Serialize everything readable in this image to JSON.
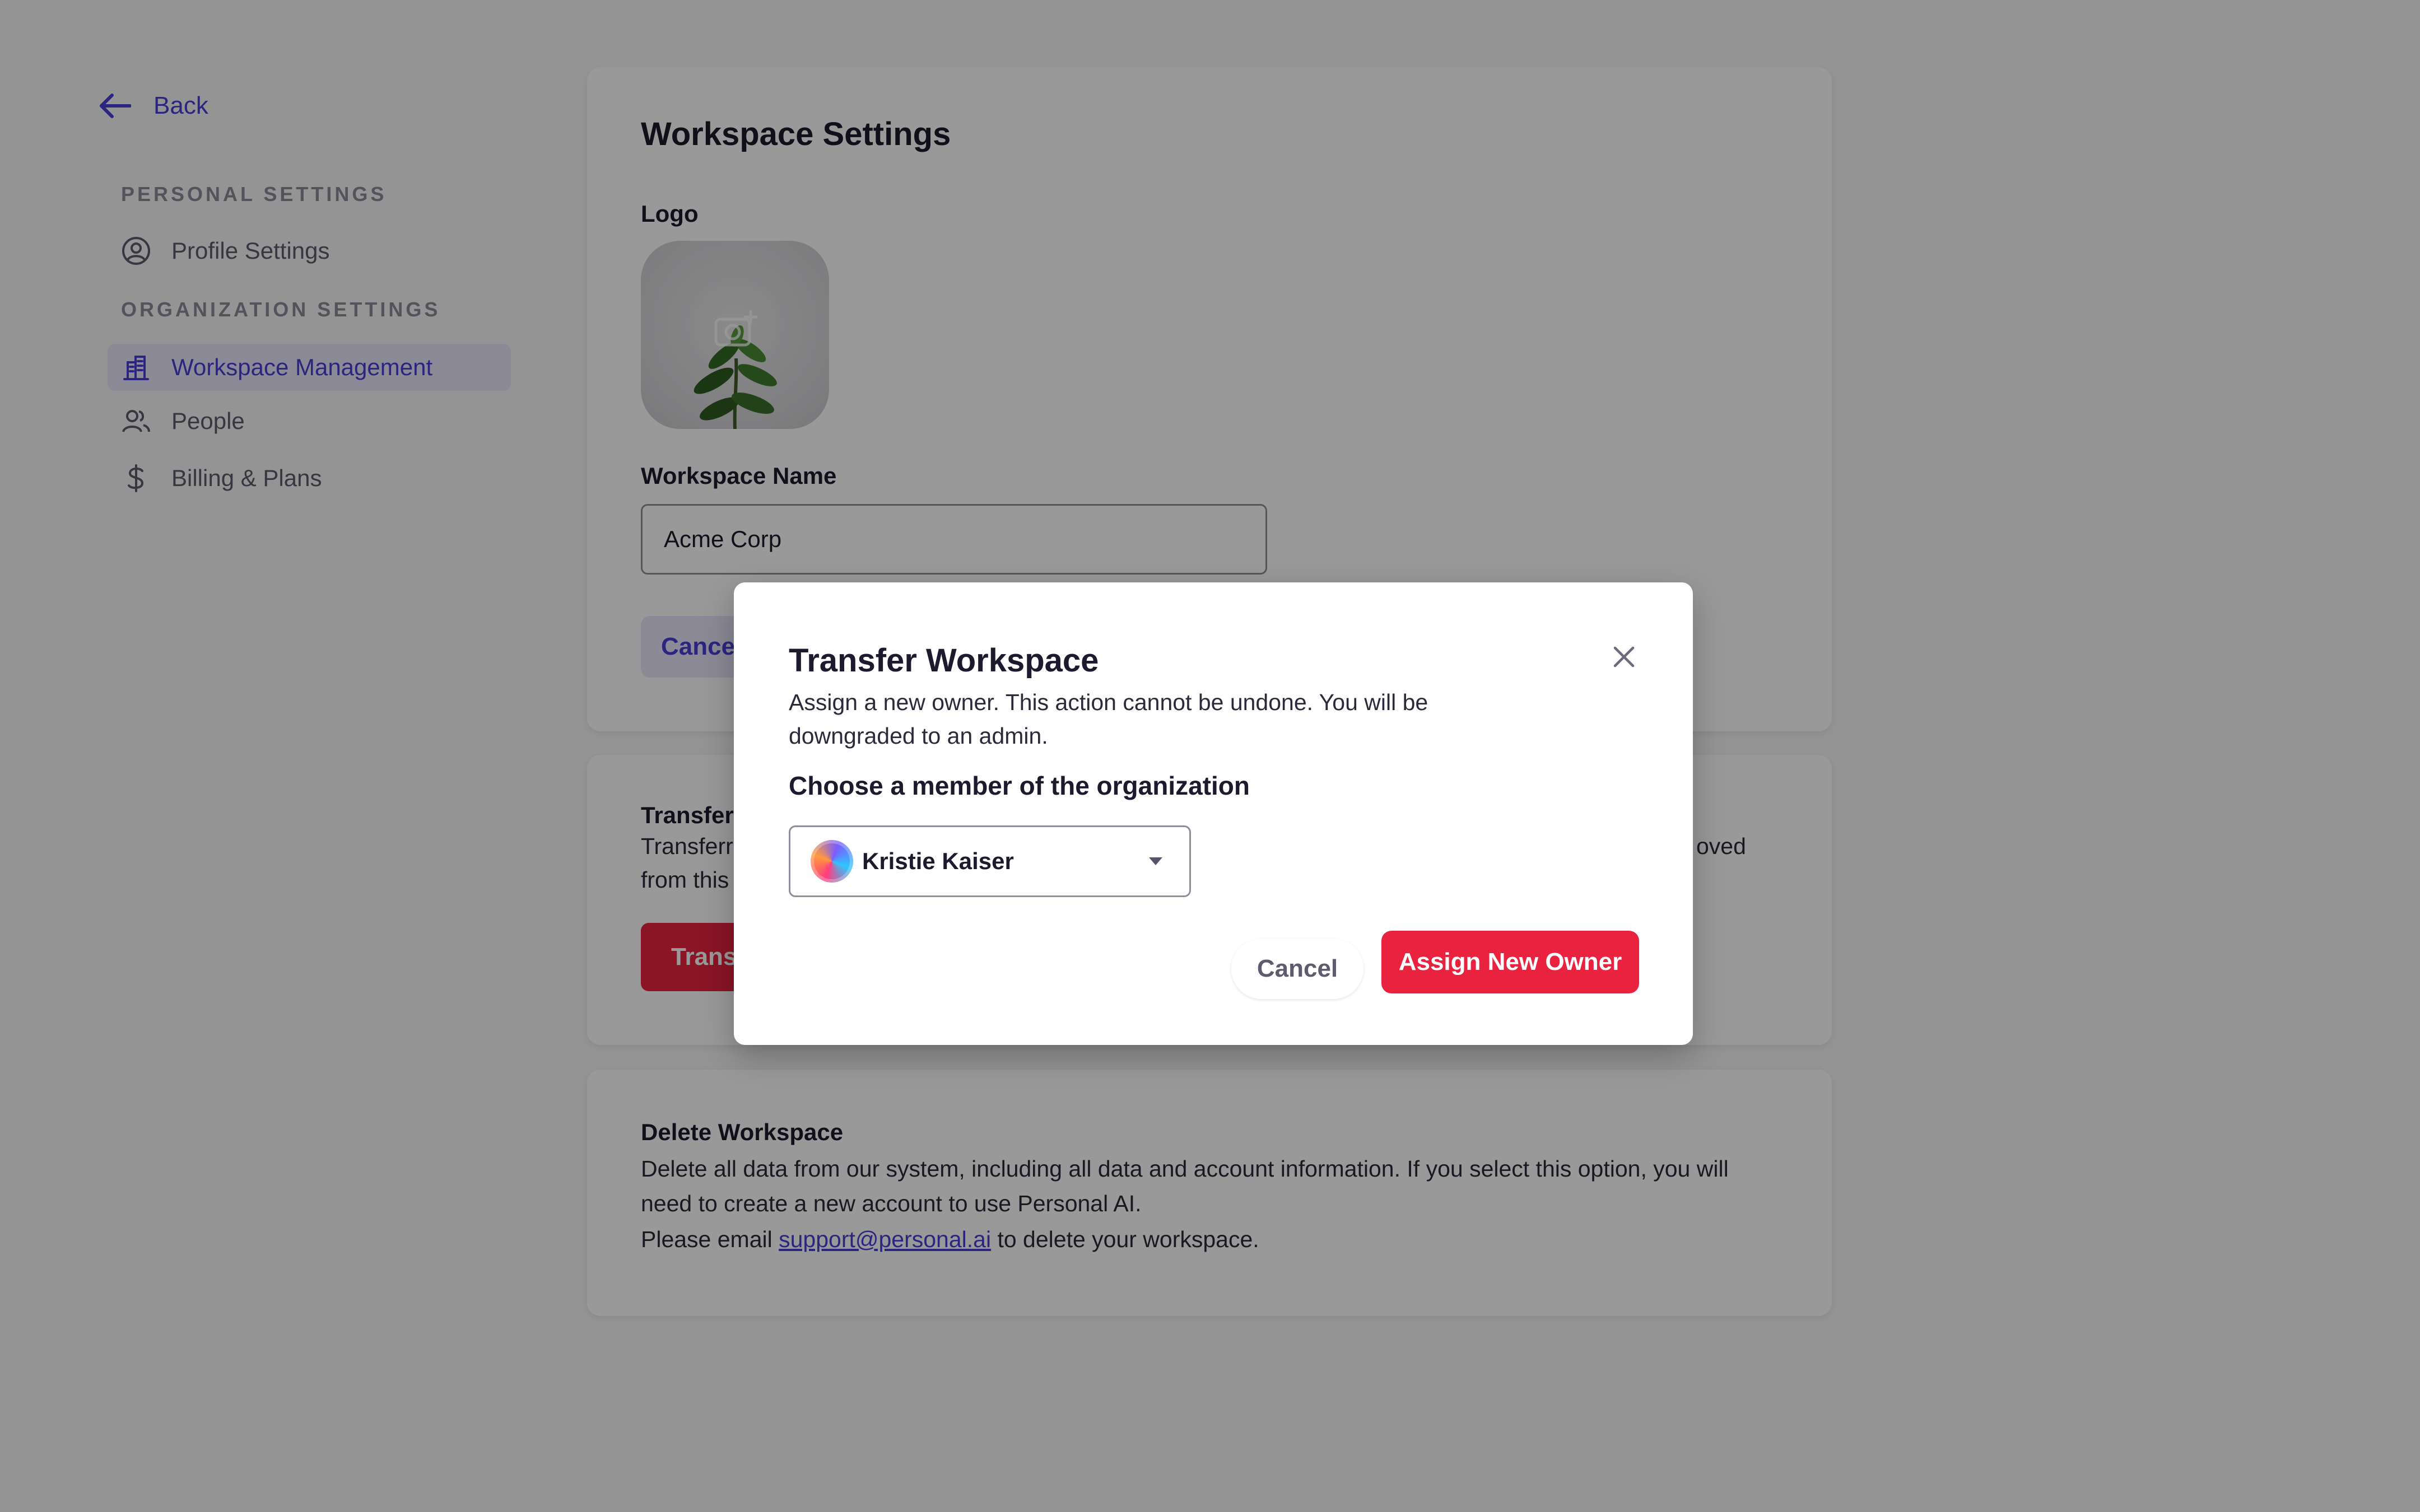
{
  "sidebar": {
    "back_label": "Back",
    "personal_heading": "PERSONAL SETTINGS",
    "organization_heading": "ORGANIZATION SETTINGS",
    "items": [
      {
        "label": "Profile Settings",
        "icon": "user-circle-icon"
      },
      {
        "label": "Workspace Management",
        "icon": "building-icon",
        "active": true
      },
      {
        "label": "People",
        "icon": "people-icon"
      },
      {
        "label": "Billing & Plans",
        "icon": "dollar-icon"
      }
    ]
  },
  "workspace": {
    "title": "Workspace Settings",
    "logo_label": "Logo",
    "name_label": "Workspace Name",
    "name_value": "Acme Corp",
    "cancel_label": "Cance"
  },
  "transfer_card": {
    "title": "Transfer",
    "line1_start": "Transferr",
    "line1_end": "oved",
    "line2_start": "from this",
    "button_label": "Trans"
  },
  "delete_card": {
    "title": "Delete Workspace",
    "line1": "Delete all data from our system, including all data and account information. If you select this option, you will",
    "line2": "need to create a new account to use Personal AI.",
    "email_prefix": "Please email ",
    "email": "support@personal.ai",
    "email_suffix": " to delete your workspace."
  },
  "modal": {
    "title": "Transfer Workspace",
    "desc_line1": "Assign a new owner. This action cannot be undone. You will be",
    "desc_line2": "downgraded to an admin.",
    "choose_label": "Choose a member of the organization",
    "selected_member": "Kristie Kaiser",
    "cancel_label": "Cancel",
    "assign_label": "Assign New Owner"
  },
  "colors": {
    "accent": "#4a3fd6",
    "danger": "#e8223f",
    "overlay": "rgba(0,0,0,0.40)"
  }
}
